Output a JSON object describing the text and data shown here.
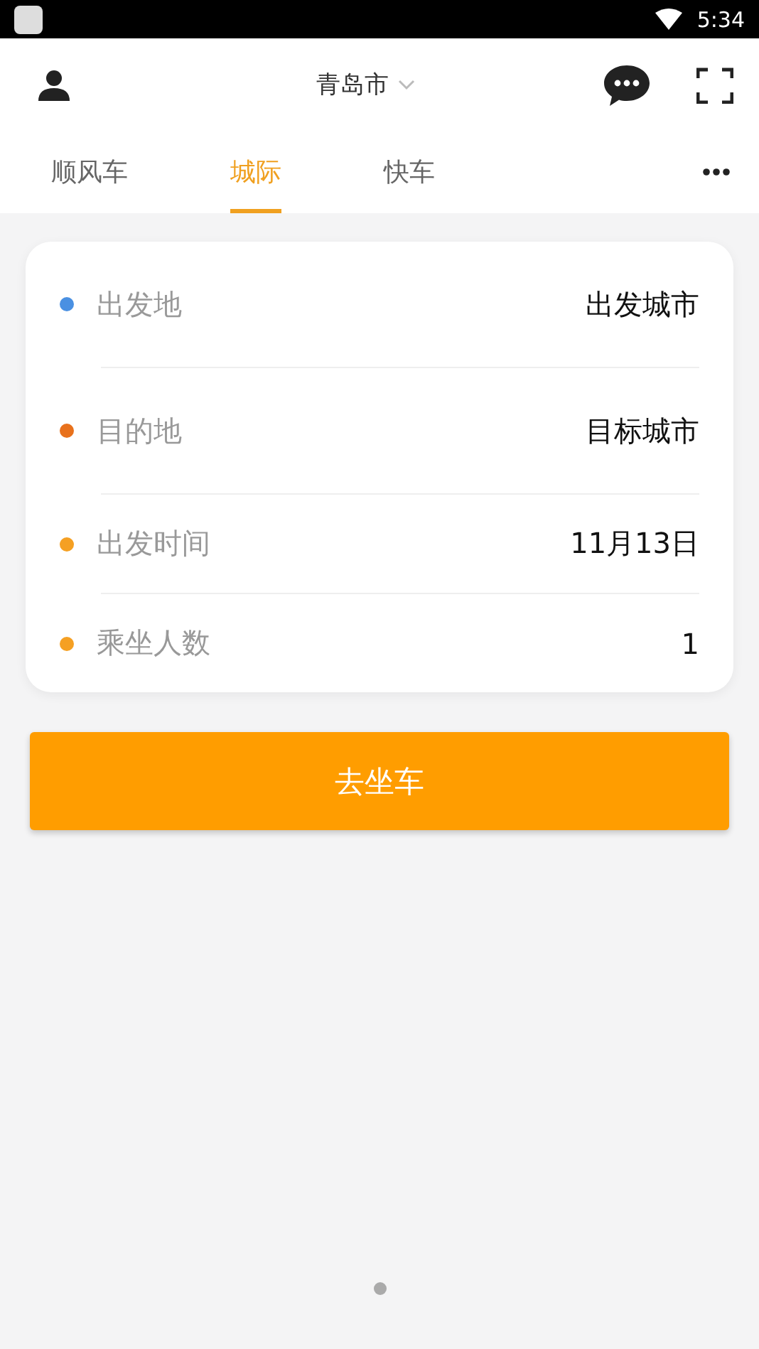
{
  "status_bar": {
    "time": "5:34"
  },
  "header": {
    "city": "青岛市"
  },
  "tabs": [
    {
      "label": "顺风车",
      "selected": false
    },
    {
      "label": "城际",
      "selected": true
    },
    {
      "label": "快车",
      "selected": false
    }
  ],
  "trip_form": {
    "fields": [
      {
        "label": "出发地",
        "value": "出发城市",
        "color": "#4a90e2"
      },
      {
        "label": "目的地",
        "value": "目标城市",
        "color": "#e8711c"
      },
      {
        "label": "出发时间",
        "value": "11月13日",
        "color": "#f5a023"
      },
      {
        "label": "乘坐人数",
        "value": "1",
        "color": "#f5a023"
      }
    ]
  },
  "submit_button": "去坐车"
}
